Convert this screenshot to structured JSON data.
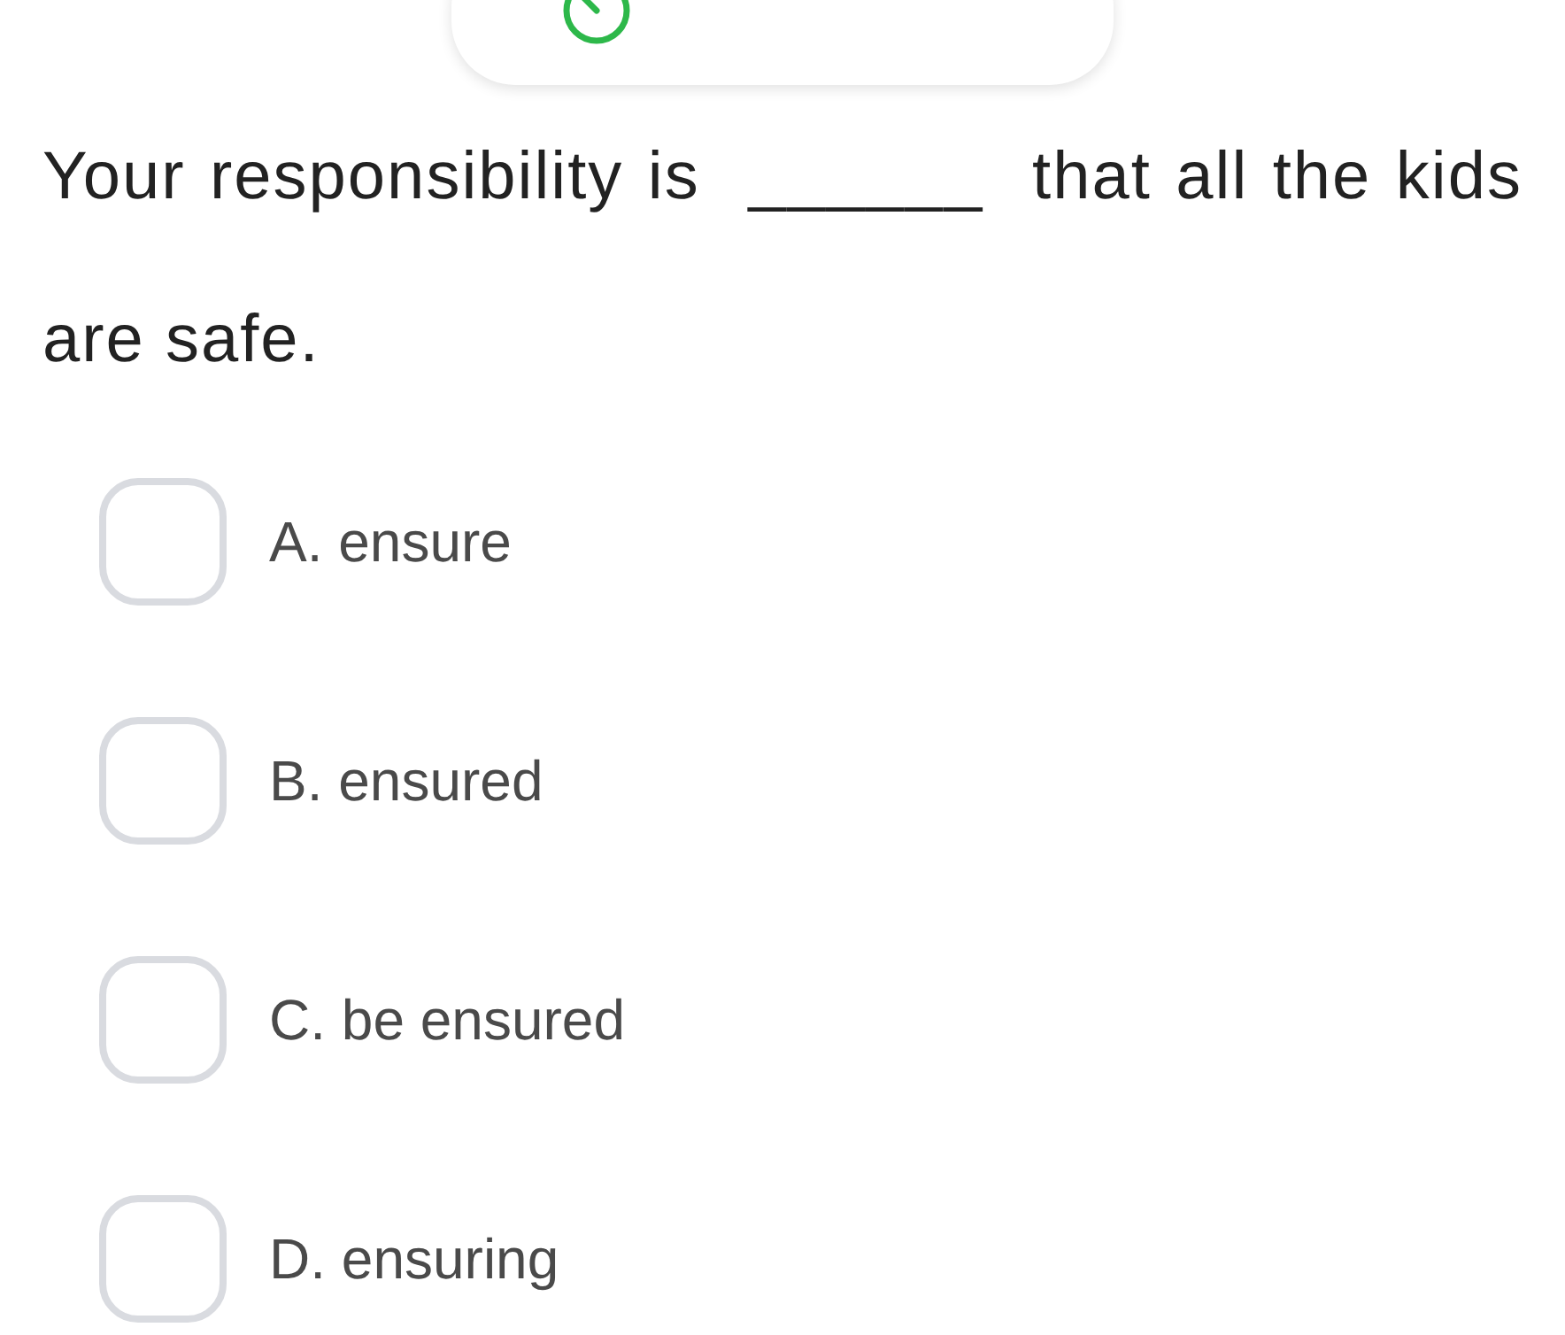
{
  "question": {
    "before": "Your responsibility is",
    "blank": "______",
    "after": "that all the kids are safe."
  },
  "options": [
    {
      "label": "A. ensure",
      "selected": false
    },
    {
      "label": "B. ensured",
      "selected": false
    },
    {
      "label": "C. be ensured",
      "selected": false
    },
    {
      "label": "D. ensuring",
      "selected": false
    }
  ]
}
